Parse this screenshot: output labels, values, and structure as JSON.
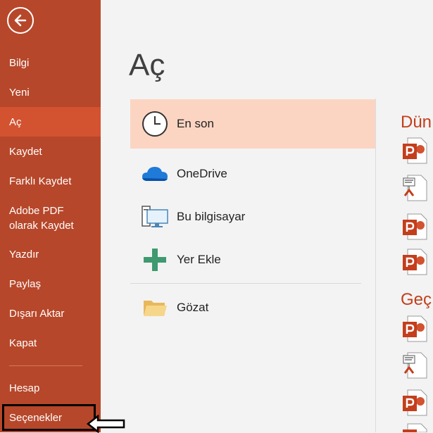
{
  "sidebar": {
    "back_icon": "back-arrow-icon",
    "items": [
      {
        "label": "Bilgi"
      },
      {
        "label": "Yeni"
      },
      {
        "label": "Aç"
      },
      {
        "label": "Kaydet"
      },
      {
        "label": "Farklı Kaydet"
      },
      {
        "label": "Adobe PDF\nolarak Kaydet"
      },
      {
        "label": "Yazdır"
      },
      {
        "label": "Paylaş"
      },
      {
        "label": "Dışarı Aktar"
      },
      {
        "label": "Kapat"
      },
      {
        "label": "Hesap"
      },
      {
        "label": "Seçenekler"
      }
    ],
    "active": "Aç"
  },
  "main": {
    "title": "Aç",
    "locations": [
      {
        "label": "En son",
        "icon": "clock-icon"
      },
      {
        "label": "OneDrive",
        "icon": "cloud-icon"
      },
      {
        "label": "Bu bilgisayar",
        "icon": "computer-icon"
      },
      {
        "label": "Yer Ekle",
        "icon": "plus-icon"
      },
      {
        "label": "Gözat",
        "icon": "folder-icon"
      }
    ]
  },
  "recent": {
    "sections": [
      {
        "heading": "Dün"
      },
      {
        "heading": "Geç"
      }
    ]
  },
  "colors": {
    "sidebar": "#b7472a",
    "sidebar_active": "#d35230",
    "location_active": "#fcd5c2",
    "accent": "#c43e1c"
  }
}
